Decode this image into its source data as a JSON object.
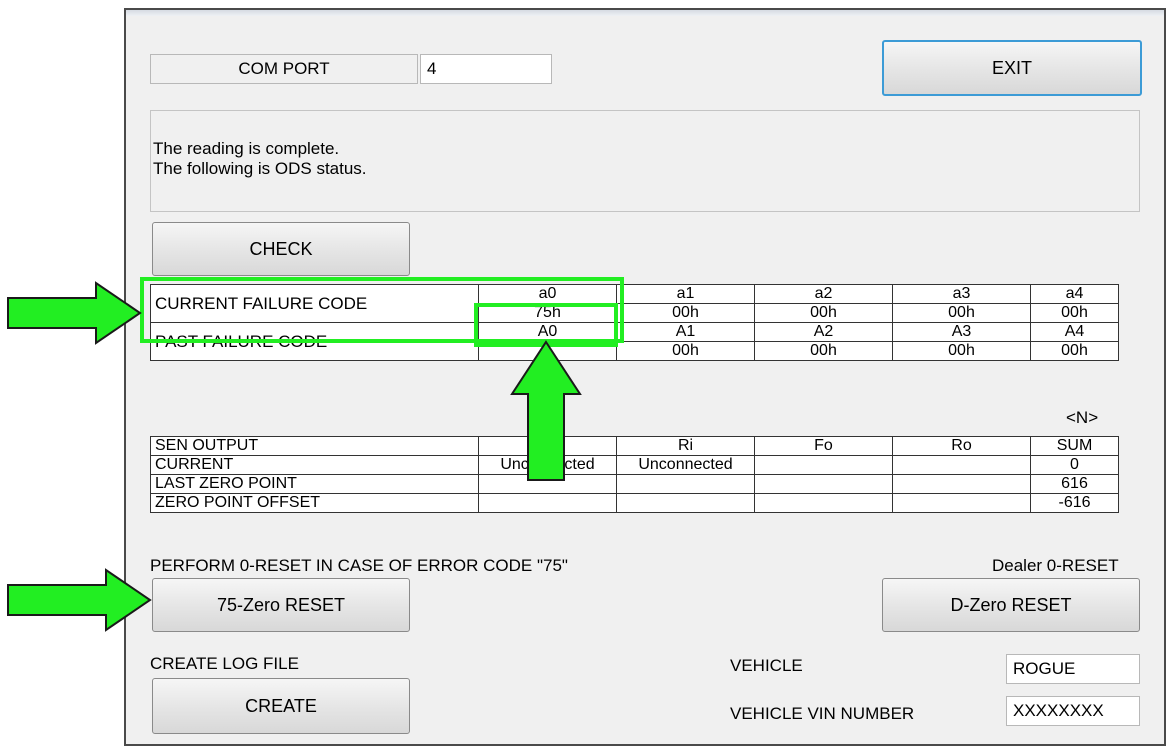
{
  "com_port": {
    "label": "COM PORT",
    "value": "4"
  },
  "exit_label": "EXIT",
  "message": {
    "line1": "The reading is complete.",
    "line2": "The following is ODS status."
  },
  "check_label": "CHECK",
  "failure_table": {
    "current_label": "CURRENT FAILURE CODE",
    "past_label": "PAST FAILURE CODE",
    "current_headers": [
      "a0",
      "a1",
      "a2",
      "a3",
      "a4"
    ],
    "current_values": [
      "75h",
      "00h",
      "00h",
      "00h",
      "00h"
    ],
    "past_headers": [
      "A0",
      "A1",
      "A2",
      "A3",
      "A4"
    ],
    "past_values": [
      "",
      "00h",
      "00h",
      "00h",
      "00h"
    ]
  },
  "unit_label": "<N>",
  "sensor_table": {
    "headers": [
      "SEN OUTPUT",
      "",
      "Ri",
      "Fo",
      "Ro",
      "SUM"
    ],
    "rows": [
      {
        "label": "CURRENT",
        "values": [
          "Unconnected",
          "Unconnected",
          "",
          "",
          "0"
        ]
      },
      {
        "label": "LAST ZERO POINT",
        "values": [
          "",
          "",
          "",
          "",
          "616"
        ]
      },
      {
        "label": "ZERO POINT OFFSET",
        "values": [
          "",
          "",
          "",
          "",
          "-616"
        ]
      }
    ]
  },
  "reset_note": "PERFORM 0-RESET IN CASE OF ERROR CODE \"75\"",
  "dealer_reset_label": "Dealer 0-RESET",
  "zero_reset_75_label": "75-Zero RESET",
  "d_zero_reset_label": "D-Zero RESET",
  "create_log_label": "CREATE LOG FILE",
  "create_label": "CREATE",
  "vehicle": {
    "label": "VEHICLE",
    "value": "ROGUE"
  },
  "vin": {
    "label": "VEHICLE VIN NUMBER",
    "value": "XXXXXXXX"
  },
  "colors": {
    "highlight": "#22ee22",
    "focus_border": "#3c9bd6",
    "window_bg": "#f0f0f0"
  }
}
